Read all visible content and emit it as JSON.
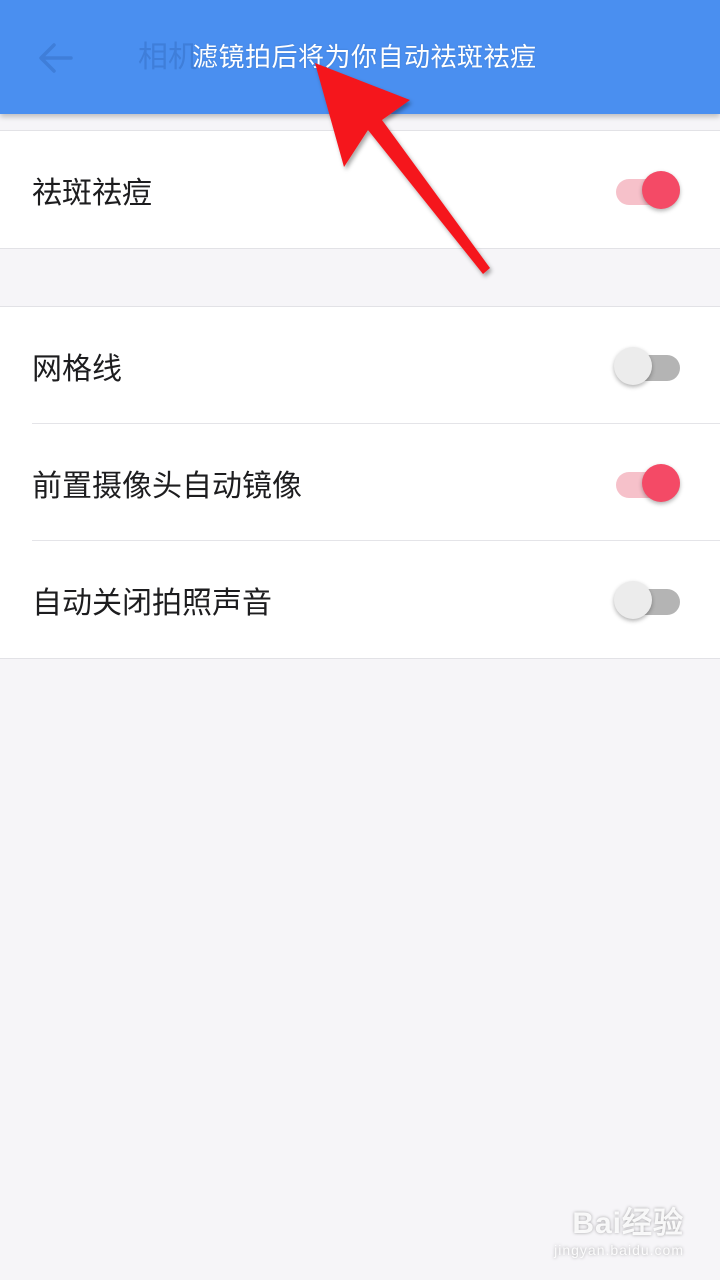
{
  "appbar": {
    "title": "相机",
    "back_icon": "arrow-left-icon",
    "overlay_caption": "滤镜拍后将为你自动祛斑祛痘"
  },
  "section1": {
    "items": [
      {
        "label": "祛斑祛痘",
        "enabled": true
      }
    ]
  },
  "section2": {
    "items": [
      {
        "label": "网格线",
        "enabled": false
      },
      {
        "label": "前置摄像头自动镜像",
        "enabled": true
      },
      {
        "label": "自动关闭拍照声音",
        "enabled": false
      }
    ]
  },
  "colors": {
    "appbar": "#4a8ff0",
    "toggle_on": "#f44a66",
    "toggle_on_track": "#f6c1ca",
    "toggle_off_track": "#b4b4b4",
    "annotation_arrow": "#f5141e"
  },
  "watermark": {
    "main": "Bai经验",
    "sub": "jingyan.baidu.com"
  }
}
